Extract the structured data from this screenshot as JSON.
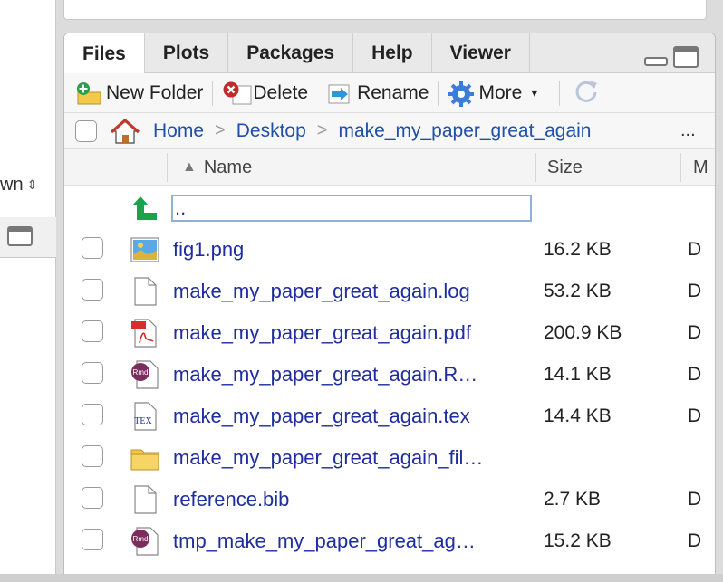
{
  "left_pane": {
    "dropdown_label": "wn",
    "dropdown_arrows": "⇕"
  },
  "tabs": [
    {
      "label": "Files",
      "active": true
    },
    {
      "label": "Plots",
      "active": false
    },
    {
      "label": "Packages",
      "active": false
    },
    {
      "label": "Help",
      "active": false
    },
    {
      "label": "Viewer",
      "active": false
    }
  ],
  "toolbar": {
    "new_folder": "New Folder",
    "delete": "Delete",
    "rename": "Rename",
    "more": "More",
    "more_caret": "▾"
  },
  "breadcrumb": {
    "home": "Home",
    "sep": ">",
    "items": [
      "Desktop",
      "make_my_paper_great_again"
    ],
    "overflow": "..."
  },
  "columns": {
    "sort_indicator": "▲",
    "name": "Name",
    "size": "Size",
    "modified": "M"
  },
  "updir": {
    "label": ".."
  },
  "files": [
    {
      "name": "fig1.png",
      "size": "16.2 KB",
      "modified": "D",
      "icon": "image-file-icon"
    },
    {
      "name": "make_my_paper_great_again.log",
      "size": "53.2 KB",
      "modified": "D",
      "icon": "blank-file-icon"
    },
    {
      "name": "make_my_paper_great_again.pdf",
      "size": "200.9 KB",
      "modified": "D",
      "icon": "pdf-file-icon"
    },
    {
      "name": "make_my_paper_great_again.R…",
      "size": "14.1 KB",
      "modified": "D",
      "icon": "rmd-file-icon"
    },
    {
      "name": "make_my_paper_great_again.tex",
      "size": "14.4 KB",
      "modified": "D",
      "icon": "tex-file-icon"
    },
    {
      "name": "make_my_paper_great_again_fil…",
      "size": "",
      "modified": "",
      "icon": "folder-icon"
    },
    {
      "name": "reference.bib",
      "size": "2.7 KB",
      "modified": "D",
      "icon": "blank-file-icon"
    },
    {
      "name": "tmp_make_my_paper_great_ag…",
      "size": "15.2 KB",
      "modified": "D",
      "icon": "rmd-file-icon"
    }
  ],
  "icon_text": {
    "rmd": "Rmd",
    "tex": "TEX"
  },
  "colors": {
    "link": "#1f2d9e",
    "crumb": "#1e50a8",
    "delete_red": "#c62828",
    "new_folder_green": "#2e9e4a",
    "gear_blue": "#3b7dd8",
    "updir_green": "#1aa34a",
    "rmd_purple": "#7b2d5e"
  }
}
